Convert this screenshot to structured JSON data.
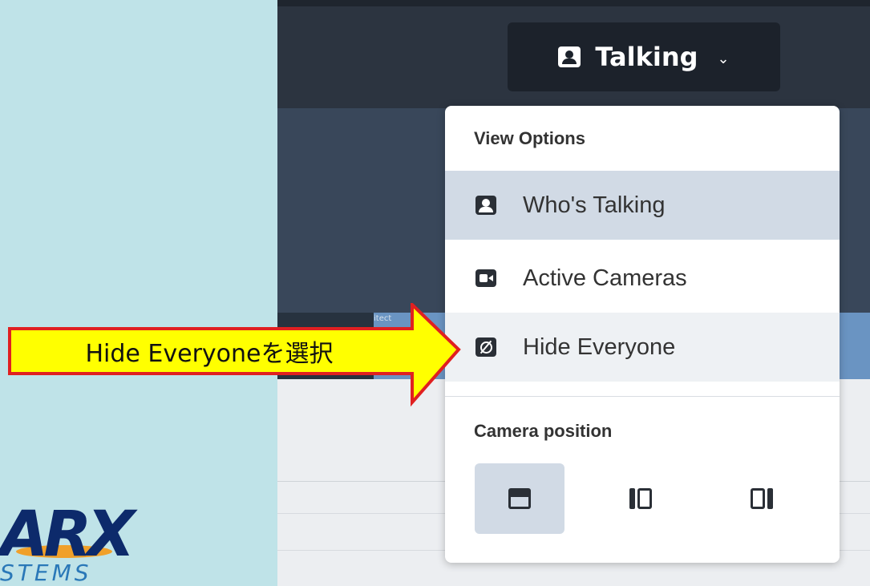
{
  "header": {
    "view_button_label": "Talking",
    "view_button_icon": "user-square-icon",
    "chevron": "⌄"
  },
  "video": {
    "tile_label": "itect"
  },
  "menu": {
    "view_options_heading": "View Options",
    "items": [
      {
        "label": "Who's Talking",
        "icon": "user-square-icon",
        "state": "selected"
      },
      {
        "label": "Active Cameras",
        "icon": "video-camera-icon",
        "state": "normal"
      },
      {
        "label": "Hide Everyone",
        "icon": "eye-off-icon",
        "state": "hover"
      }
    ],
    "camera_position_heading": "Camera position",
    "positions": [
      {
        "icon": "layout-top-icon",
        "selected": true
      },
      {
        "icon": "layout-left-icon",
        "selected": false
      },
      {
        "icon": "layout-right-icon",
        "selected": false
      }
    ]
  },
  "callout": {
    "text": "Hide Everyoneを選択",
    "fill_color": "#ffff00",
    "border_color": "#e02020"
  },
  "logo": {
    "word": "ARX",
    "subtitle": "STEMS"
  }
}
